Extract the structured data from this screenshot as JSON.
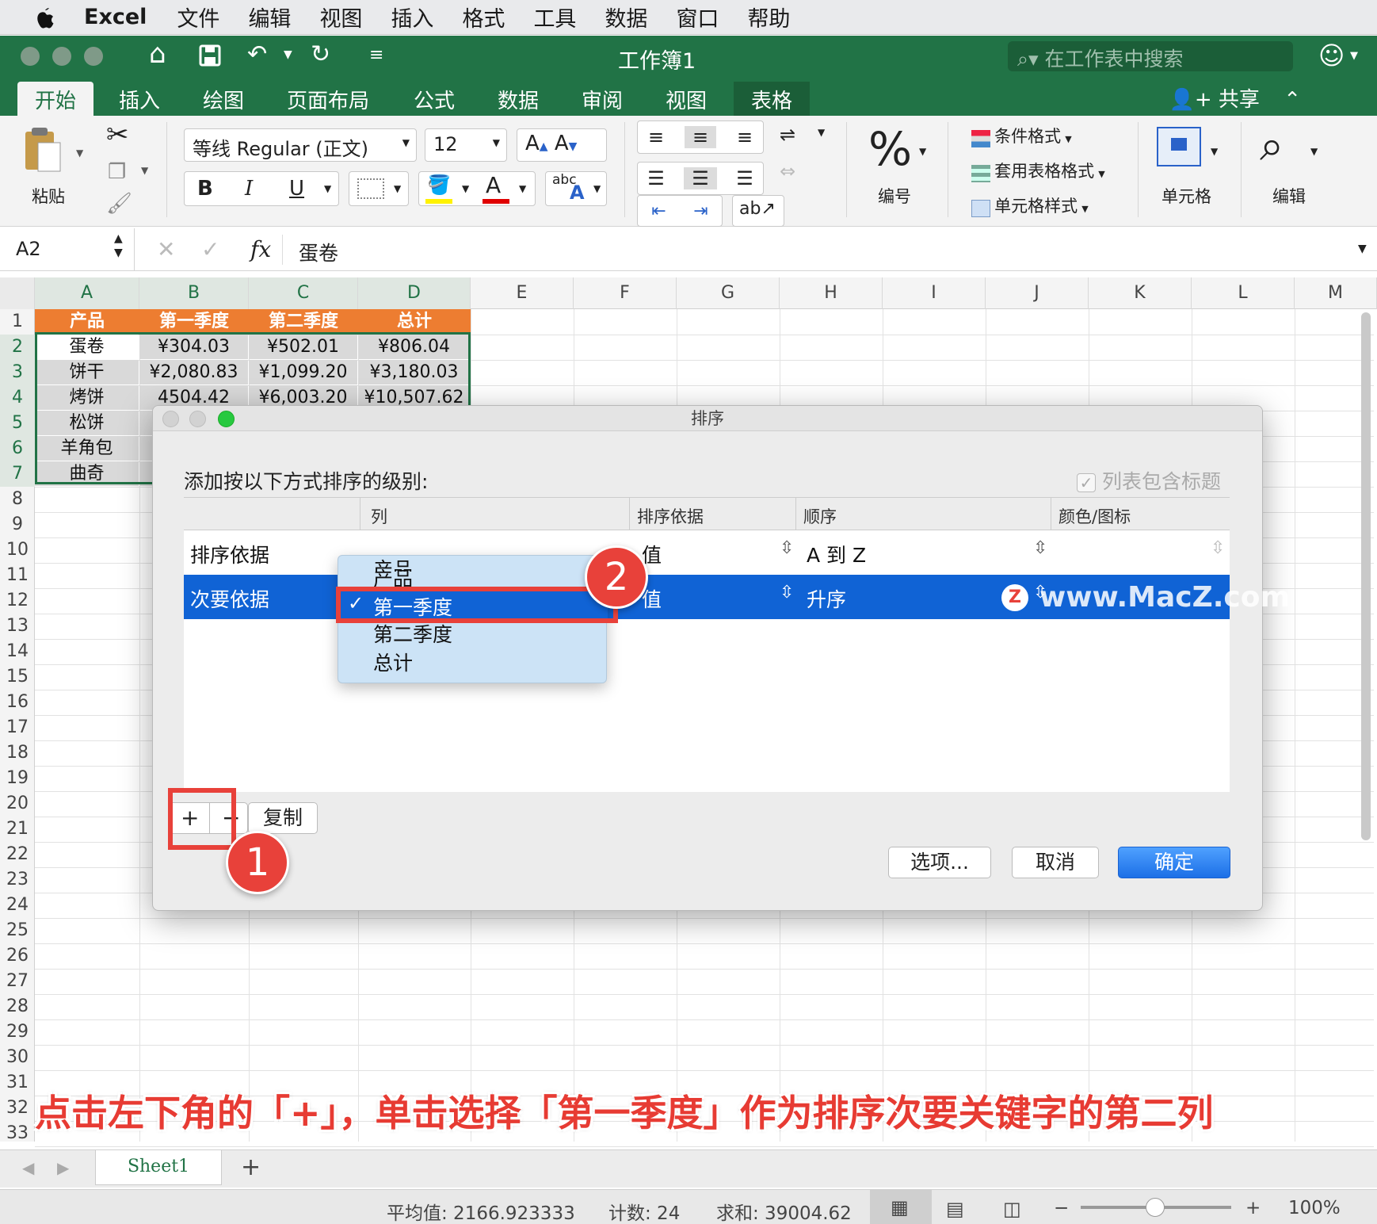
{
  "menubar": {
    "app": "Excel",
    "items": [
      "文件",
      "编辑",
      "视图",
      "插入",
      "格式",
      "工具",
      "数据",
      "窗口",
      "帮助"
    ]
  },
  "titlebar": {
    "title": "工作簿1",
    "search_placeholder": "在工作表中搜索"
  },
  "ribbon_tabs": {
    "items": [
      "开始",
      "插入",
      "绘图",
      "页面布局",
      "公式",
      "数据",
      "审阅",
      "视图",
      "表格"
    ],
    "share": "共享"
  },
  "ribbon": {
    "paste": "粘贴",
    "font_name": "等线 Regular (正文)",
    "font_size": "12",
    "bold": "B",
    "italic": "I",
    "underline": "U",
    "grow": "A",
    "shrink": "A",
    "color_a": "A",
    "abc": "abc",
    "number": "编号",
    "cond_format": "条件格式",
    "table_format": "套用表格格式",
    "cell_style": "单元格样式",
    "cells": "单元格",
    "edit": "编辑"
  },
  "formula_bar": {
    "name_box": "A2",
    "fx": "fx",
    "content": "蛋卷"
  },
  "columns": [
    "A",
    "B",
    "C",
    "D",
    "E",
    "F",
    "G",
    "H",
    "I",
    "J",
    "K",
    "L",
    "M"
  ],
  "rows": [
    "1",
    "2",
    "3",
    "4",
    "5",
    "6",
    "7",
    "8",
    "9",
    "10",
    "11",
    "12",
    "13",
    "14",
    "15",
    "16",
    "17",
    "18",
    "19",
    "20",
    "21",
    "22",
    "23",
    "24",
    "25",
    "26",
    "27",
    "28",
    "29",
    "30",
    "31",
    "32",
    "33"
  ],
  "table": {
    "headers": [
      "产品",
      "第一季度",
      "第二季度",
      "总计"
    ],
    "rows": [
      [
        "蛋卷",
        "¥304.03",
        "¥502.01",
        "¥806.04"
      ],
      [
        "饼干",
        "¥2,080.83",
        "¥1,099.20",
        "¥3,180.03"
      ],
      [
        "烤饼",
        "4504.42",
        "¥6,003.20",
        "¥10,507.62"
      ],
      [
        "松饼",
        "",
        "",
        ""
      ],
      [
        "羊角包",
        "",
        "",
        ""
      ],
      [
        "曲奇",
        "",
        "",
        ""
      ]
    ]
  },
  "dialog": {
    "title": "排序",
    "instruction": "添加按以下方式排序的级别:",
    "has_header_label": "列表包含标题",
    "col_headers": [
      "列",
      "排序依据",
      "顺序",
      "颜色/图标"
    ],
    "levels": [
      {
        "label": "排序依据",
        "column": "产品",
        "sort_on": "值",
        "order": "A 到 Z"
      },
      {
        "label": "次要依据",
        "column": "第一季度",
        "sort_on": "值",
        "order": "升序"
      }
    ],
    "add": "+",
    "remove": "−",
    "copy": "复制",
    "options": "选项...",
    "cancel": "取消",
    "ok": "确定"
  },
  "popup": {
    "items": [
      "产品",
      "第一季度",
      "第二季度",
      "总计"
    ],
    "selected": "第一季度",
    "check": "✓"
  },
  "annotations": {
    "badge1": "1",
    "badge2": "2",
    "watermark": "www.MacZ.com",
    "caption": "点击左下角的「+」，单击选择「第一季度」作为排序次要关键字的第二列"
  },
  "sheetbar": {
    "sheet": "Sheet1",
    "add": "+"
  },
  "statusbar": {
    "avg": "平均值: 2166.923333",
    "count": "计数: 24",
    "sum": "求和: 39004.62",
    "zoom": "100%"
  }
}
